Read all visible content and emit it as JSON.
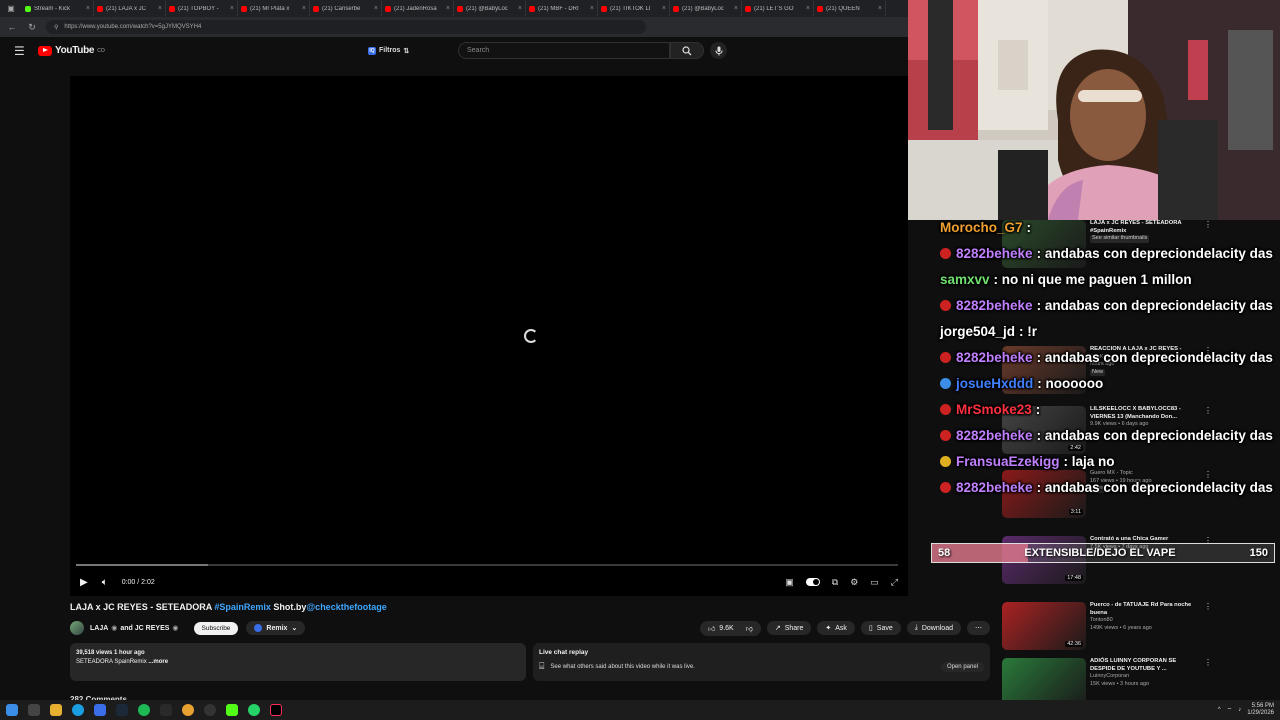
{
  "browser": {
    "tabs": [
      {
        "label": "Stream - Kick",
        "color": "#53fc18"
      },
      {
        "label": "(21) LAJA x JC",
        "color": "#ff0000"
      },
      {
        "label": "(21) TOPBOY -",
        "color": "#ff0000"
      },
      {
        "label": "(21) Mr Plata x",
        "color": "#ff0000"
      },
      {
        "label": "(21) Canserbe",
        "color": "#ff0000"
      },
      {
        "label": "(21) JadenRosa",
        "color": "#ff0000"
      },
      {
        "label": "(21) @BabyLoc",
        "color": "#ff0000"
      },
      {
        "label": "(21) MBF - DRI",
        "color": "#ff0000"
      },
      {
        "label": "(21) TIKTOK LI",
        "color": "#ff0000"
      },
      {
        "label": "(21) @BabyLoc",
        "color": "#ff0000"
      },
      {
        "label": "(21) LET'S GO",
        "color": "#ff0000"
      },
      {
        "label": "(21) QUEEN",
        "color": "#ff0000"
      }
    ],
    "url": "https://www.youtube.com/watch?v=5gJYMQVSYH4"
  },
  "header": {
    "logo_text": "YouTube",
    "logo_sup": "CO",
    "filters_label": "Filtros",
    "search_placeholder": "Search"
  },
  "player": {
    "time": "0:00 / 2:02",
    "buffered_fraction": 0.16
  },
  "video": {
    "title_main": "LAJA x JC REYES - SETEADORA ",
    "title_tag": "#SpainRemix",
    "title_mid": " Shot.by",
    "title_handle": "@checkthefootage",
    "channel": "LAJA",
    "channel_and": "and JC REYES",
    "subscribe": "Subscribe",
    "remix": "Remix",
    "likes": "9.6K",
    "share": "Share",
    "ask": "Ask",
    "save": "Save",
    "download": "Download",
    "views": "39,518 views  1 hour ago",
    "desc_snippet": "SETEADORA SpainRemix",
    "more": "...more",
    "comments_peek": "282 Comments"
  },
  "livechat": {
    "title": "Live chat replay",
    "text": "See what others said about this video while it was live.",
    "open": "Open panel"
  },
  "sidebar": [
    {
      "title": "LAJA x JC REYES - SETEADORA #SpainRemix",
      "channel": "",
      "meta": "",
      "badge": "See similar thumbnails",
      "duration": "",
      "color": "#2a4a2a"
    },
    {
      "title": "REACCION A LAJA x JC REYES -",
      "channel": "EduKings",
      "meta": "hours ago",
      "badge": "New",
      "duration": "",
      "color": "#6a3a2a"
    },
    {
      "title": "LILSKEELOCC X BABYLOCC83 - VIERNES 13 (Manchando Don...",
      "channel": "",
      "meta": "9.9K views • 6 days ago",
      "badge": "",
      "duration": "2:42",
      "color": "#444"
    },
    {
      "title": "",
      "channel": "Guero MX - Topic",
      "meta": "167 views • 19 hours ago",
      "badge": "New",
      "duration": "3:11",
      "color": "#8a1a1a"
    },
    {
      "title": "Contrató a una Chica Gamer ",
      "channel": "",
      "meta": "7.5K views • 7 days ago",
      "badge": "",
      "duration": "17:48",
      "color": "#5a2a6a"
    },
    {
      "title": "Puerco - de TATUAJE Rd Para noche buena",
      "channel": "Tonton80",
      "meta": "149K views • 6 years ago",
      "badge": "",
      "duration": "42:36",
      "color": "#aa2222"
    },
    {
      "title": "ADIÓS LUINNY CORPORAN SE DESPIDE DE YOUTUBE Y ...",
      "channel": "LuinnyCorporan",
      "meta": "15K views • 3 hours ago",
      "badge": "",
      "duration": "",
      "color": "#2a7a3a"
    }
  ],
  "chat": [
    {
      "user": "Morocho_G7",
      "text": "",
      "color": "#f0a030",
      "badge_color": ""
    },
    {
      "user": "8282beheke",
      "text": "andabas con depreciondelacity das",
      "color": "#c080ff",
      "badge_color": "#cc2222"
    },
    {
      "user": "samxvv",
      "text": "no ni que me paguen 1 millon",
      "color": "#70e070",
      "badge_color": ""
    },
    {
      "user": "8282beheke",
      "text": "andabas con depreciondelacity das",
      "color": "#c080ff",
      "badge_color": "#cc2222"
    },
    {
      "user": "jorge504_jd",
      "text": "!r",
      "color": "#ffffff",
      "badge_color": ""
    },
    {
      "user": "8282beheke",
      "text": "andabas con depreciondelacity das",
      "color": "#c080ff",
      "badge_color": "#cc2222"
    },
    {
      "user": "josueHxddd",
      "text": "noooooo",
      "color": "#4080ff",
      "badge_color": "#3a8ee8"
    },
    {
      "user": "MrSmoke23",
      "text": "",
      "color": "#ff3040",
      "badge_color": "#cc2222"
    },
    {
      "user": "8282beheke",
      "text": "andabas con depreciondelacity das",
      "color": "#c080ff",
      "badge_color": "#cc2222"
    },
    {
      "user": "FransuaEzekigg",
      "text": "laja no",
      "color": "#c080ff",
      "badge_color": "#e0b020"
    },
    {
      "user": "8282beheke",
      "text": "andabas con depreciondelacity das",
      "color": "#c080ff",
      "badge_color": "#cc2222"
    }
  ],
  "poll": {
    "left_count": "58",
    "label": "EXTENSIBLE/DEJO EL VAPE",
    "right_count": "150",
    "left_fraction": 0.28
  },
  "taskbar": {
    "time": "5:56 PM",
    "date": "1/29/2026"
  }
}
